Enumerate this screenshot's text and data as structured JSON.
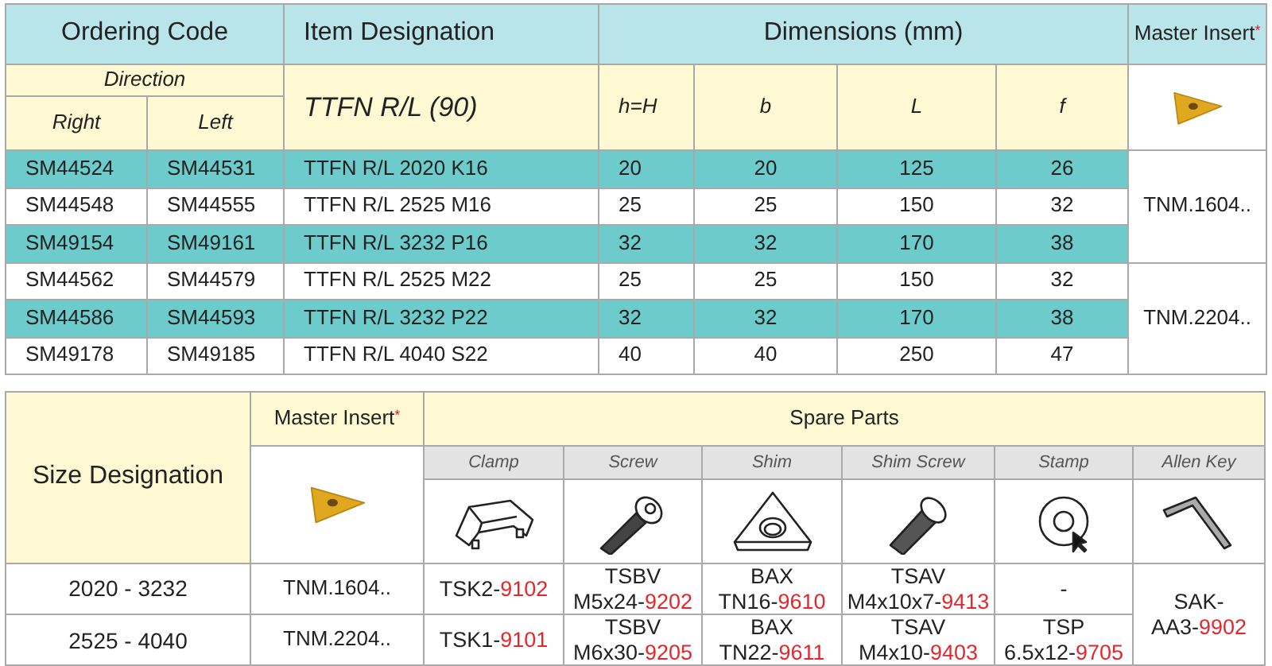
{
  "tool_table": {
    "headers": {
      "ordering_code": "Ordering Code",
      "item_designation": "Item Designation",
      "dimensions": "Dimensions (mm)",
      "master_insert": "Master Insert",
      "asterisk": "*"
    },
    "direction": "Direction",
    "right": "Right",
    "left": "Left",
    "designation_title": "TTFN R/L (90)",
    "dimension_columns": [
      "h=H",
      "b",
      "L",
      "f"
    ],
    "groups": [
      {
        "insert": "TNM.1604..",
        "rows": [
          {
            "right": "SM44524",
            "left": "SM44531",
            "designation": "TTFN R/L 2020 K16",
            "dims": [
              "20",
              "20",
              "125",
              "26"
            ],
            "shaded": true
          },
          {
            "right": "SM44548",
            "left": "SM44555",
            "designation": "TTFN R/L 2525 M16",
            "dims": [
              "25",
              "25",
              "150",
              "32"
            ],
            "shaded": false
          },
          {
            "right": "SM49154",
            "left": "SM49161",
            "designation": "TTFN R/L 3232 P16",
            "dims": [
              "32",
              "32",
              "170",
              "38"
            ],
            "shaded": true
          }
        ]
      },
      {
        "insert": "TNM.2204..",
        "rows": [
          {
            "right": "SM44562",
            "left": "SM44579",
            "designation": "TTFN R/L 2525 M22",
            "dims": [
              "25",
              "25",
              "150",
              "32"
            ],
            "shaded": false
          },
          {
            "right": "SM44586",
            "left": "SM44593",
            "designation": "TTFN R/L 3232 P22",
            "dims": [
              "32",
              "32",
              "170",
              "38"
            ],
            "shaded": true
          },
          {
            "right": "SM49178",
            "left": "SM49185",
            "designation": "TTFN R/L 4040 S22",
            "dims": [
              "40",
              "40",
              "250",
              "47"
            ],
            "shaded": false
          }
        ]
      }
    ]
  },
  "spare_table": {
    "size_designation": "Size Designation",
    "master_insert": "Master Insert",
    "asterisk": "*",
    "spare_parts": "Spare Parts",
    "columns": [
      {
        "label": "Clamp",
        "kind": "clamp"
      },
      {
        "label": "Screw",
        "kind": "screw"
      },
      {
        "label": "Shim",
        "kind": "shim"
      },
      {
        "label": "Shim Screw",
        "kind": "shim_screw"
      },
      {
        "label": "Stamp",
        "kind": "stamp"
      },
      {
        "label": "Allen Key",
        "kind": "allen_key"
      }
    ],
    "rows": [
      {
        "size": "2020 - 3232",
        "insert": "TNM.1604..",
        "parts": [
          {
            "prefix": "TSK2-",
            "ref": "9102"
          },
          {
            "prefix": "TSBV\nM5x24-",
            "ref": "9202"
          },
          {
            "prefix": "BAX\nTN16-",
            "ref": "9610"
          },
          {
            "prefix": "TSAV\nM4x10x7-",
            "ref": "9413"
          },
          {
            "prefix": "-"
          }
        ]
      },
      {
        "size": "2525 - 4040",
        "insert": "TNM.2204..",
        "parts": [
          {
            "prefix": "TSK1-",
            "ref": "9101"
          },
          {
            "prefix": "TSBV\nM6x30-",
            "ref": "9205"
          },
          {
            "prefix": "BAX\nTN22-",
            "ref": "9611"
          },
          {
            "prefix": "TSAV\nM4x10-",
            "ref": "9403"
          },
          {
            "prefix": "TSP\n6.5x12-",
            "ref": "9705"
          }
        ]
      }
    ],
    "shared_part": {
      "prefix": "SAK-\nAA3-",
      "ref": "9902"
    }
  }
}
